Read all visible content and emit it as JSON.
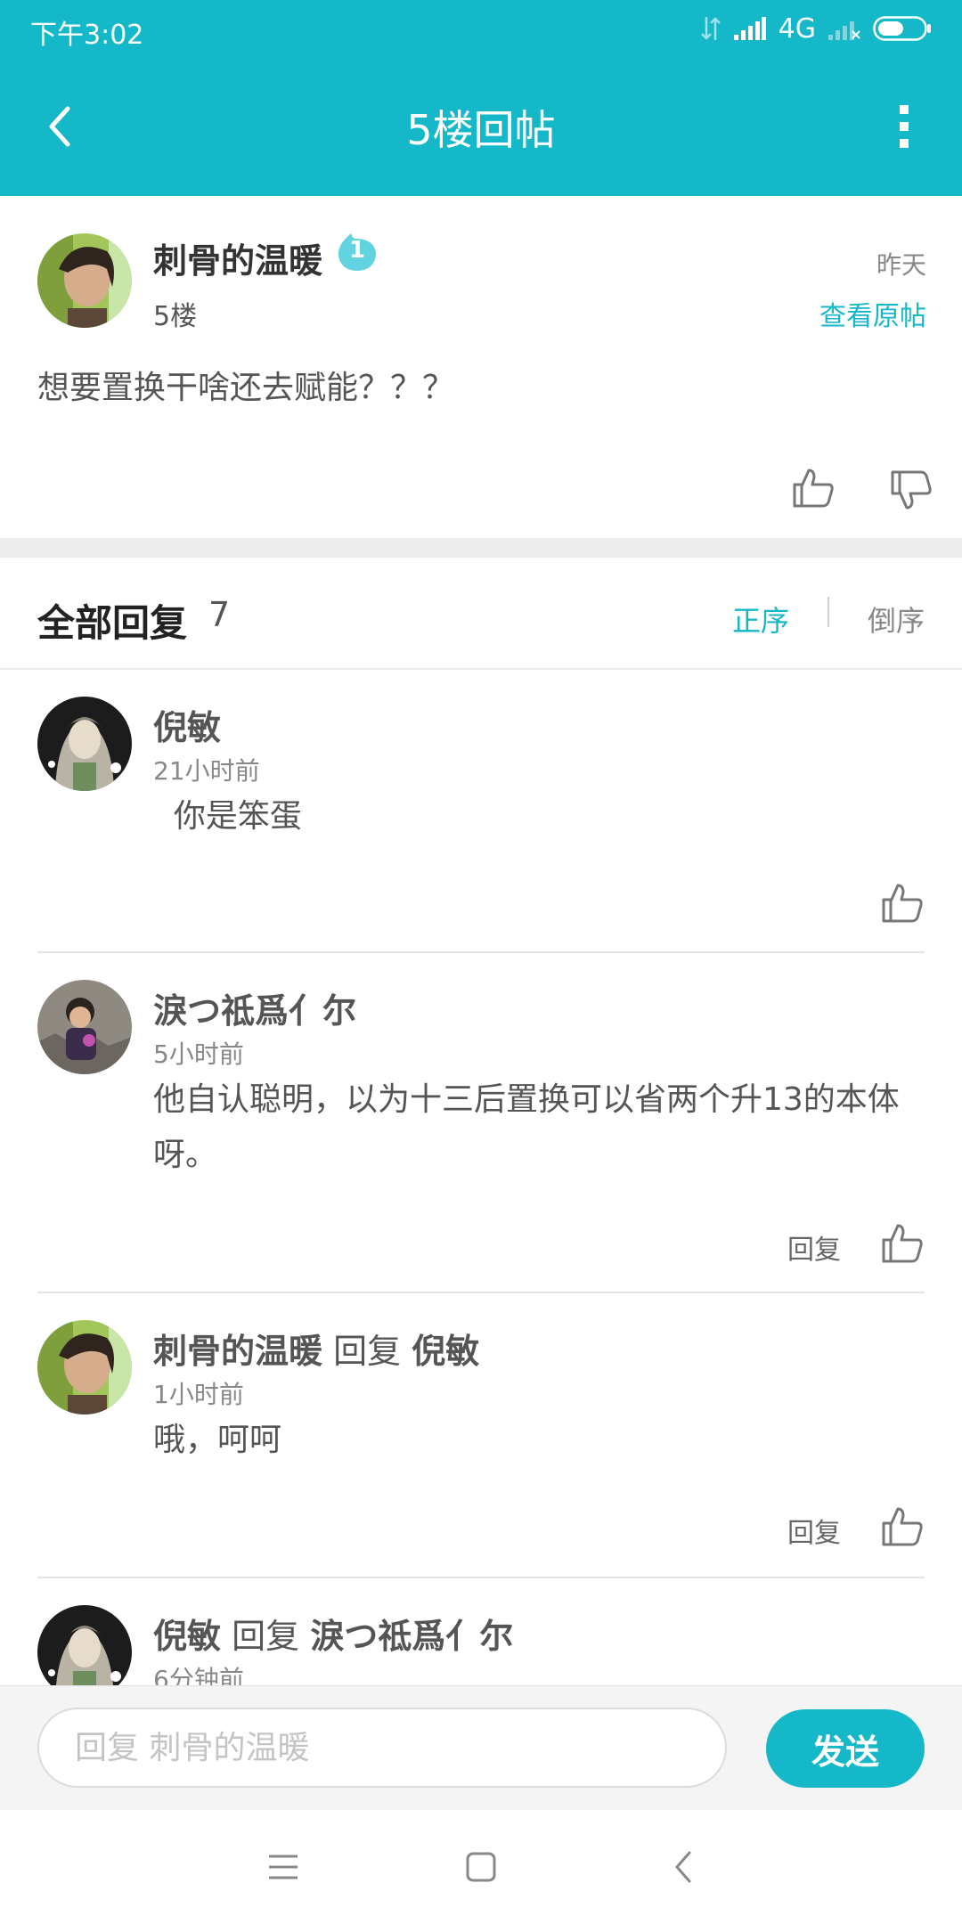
{
  "status_bar": {
    "time": "下午3:02",
    "network": "4G"
  },
  "navbar": {
    "title": "5楼回帖"
  },
  "post": {
    "author": "刺骨的温暖",
    "level": "1",
    "floor": "5楼",
    "time": "昨天",
    "view_original": "查看原帖",
    "content": "想要置换干啥还去赋能？？？"
  },
  "replies_header": {
    "title": "全部回复",
    "count": "7",
    "sort_asc": "正序",
    "sort_desc": "倒序"
  },
  "replies": [
    {
      "author": "倪敏",
      "time": "21小时前",
      "text": "  你是笨蛋"
    },
    {
      "author": "淚つ祗爲亻尔",
      "time": "5小时前",
      "text": "他自认聪明，以为十三后置换可以省两个升13的本体呀。",
      "reply_label": "回复"
    },
    {
      "author": "刺骨的温暖",
      "reply_word": "回复",
      "target": "倪敏",
      "time": "1小时前",
      "text": "哦，呵呵",
      "reply_label": "回复"
    },
    {
      "author": "倪敏",
      "reply_word": "回复",
      "target": "淚つ祗爲亻尔",
      "time": "6分钟前"
    }
  ],
  "composer": {
    "placeholder": "回复 刺骨的温暖",
    "send_label": "发送"
  },
  "colors": {
    "accent": "#15b8c8",
    "header_bg": "#15b8c8"
  }
}
